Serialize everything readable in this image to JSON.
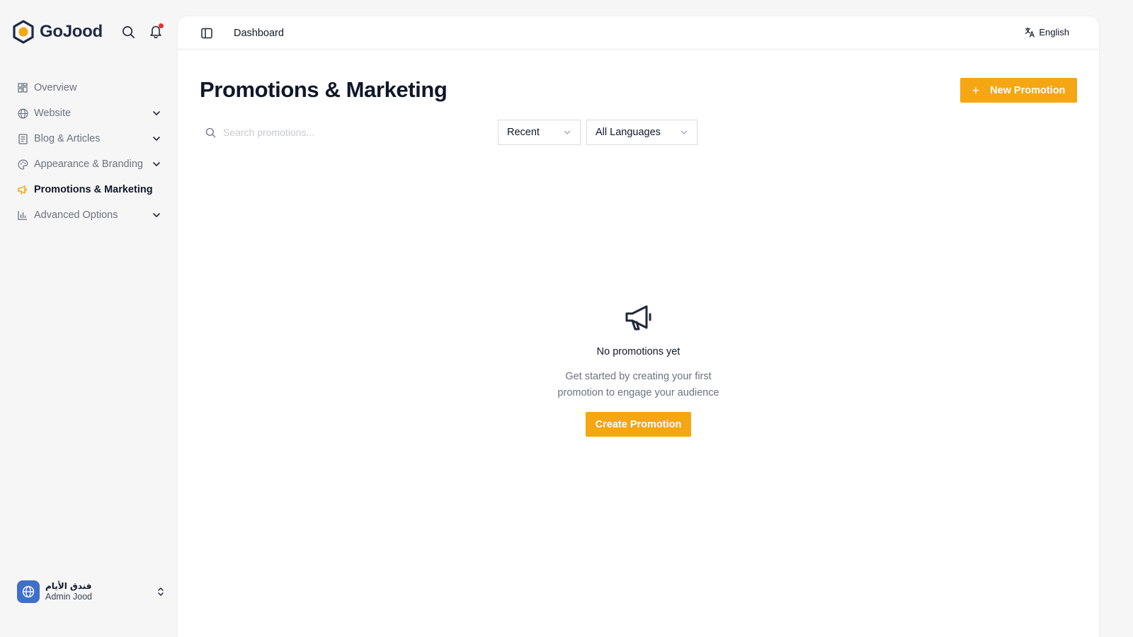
{
  "brand": {
    "name": "GoJood",
    "accent": "#f4a613",
    "logo_color": "#1f2a44"
  },
  "header_icons": {
    "search": "search-icon",
    "notifications": "bell-icon",
    "notification_dot_color": "#e5322d"
  },
  "sidebar": {
    "items": [
      {
        "label": "Overview",
        "icon": "grid-icon",
        "has_chevron": false,
        "active": false
      },
      {
        "label": "Website",
        "icon": "globe-icon",
        "has_chevron": true,
        "active": false
      },
      {
        "label": "Blog & Articles",
        "icon": "newspaper-icon",
        "has_chevron": true,
        "active": false
      },
      {
        "label": "Appearance & Branding",
        "icon": "palette-icon",
        "has_chevron": true,
        "active": false
      },
      {
        "label": "Promotions & Marketing",
        "icon": "megaphone-icon",
        "has_chevron": false,
        "active": true
      },
      {
        "label": "Advanced Options",
        "icon": "bar-chart-icon",
        "has_chevron": true,
        "active": false
      }
    ],
    "user": {
      "name": "فندق الأيام",
      "role": "Admin Jood"
    }
  },
  "topbar": {
    "breadcrumb": "Dashboard",
    "language": "English"
  },
  "main": {
    "title": "Promotions & Marketing",
    "new_button": "New Promotion",
    "search_placeholder": "Search promotions...",
    "sort_select": "Recent",
    "language_select": "All Languages",
    "empty": {
      "title": "No promotions yet",
      "desc_line1": "Get started by creating your first",
      "desc_line2": "promotion to engage your audience",
      "button": "Create Promotion"
    }
  }
}
